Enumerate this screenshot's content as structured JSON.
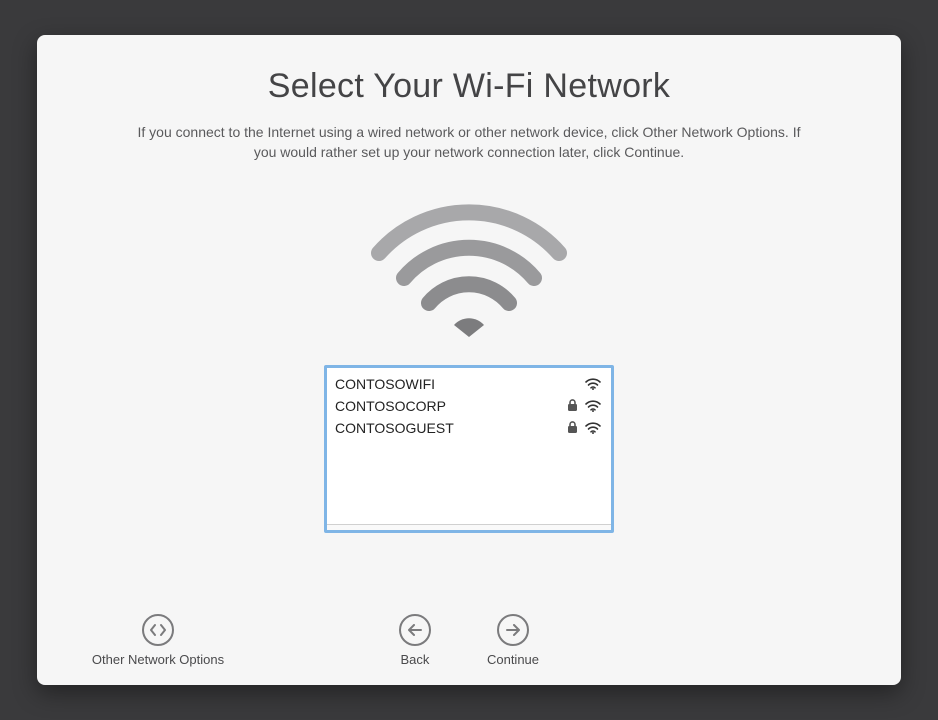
{
  "title": "Select Your Wi-Fi Network",
  "subtitle": "If you connect to the Internet using a wired network or other network device, click Other Network Options. If you would rather set up your network connection later, click Continue.",
  "networks": [
    {
      "name": "CONTOSOWIFI",
      "locked": false
    },
    {
      "name": "CONTOSOCORP",
      "locked": true
    },
    {
      "name": "CONTOSOGUEST",
      "locked": true
    }
  ],
  "buttons": {
    "other_options": "Other Network Options",
    "back": "Back",
    "continue": "Continue"
  }
}
